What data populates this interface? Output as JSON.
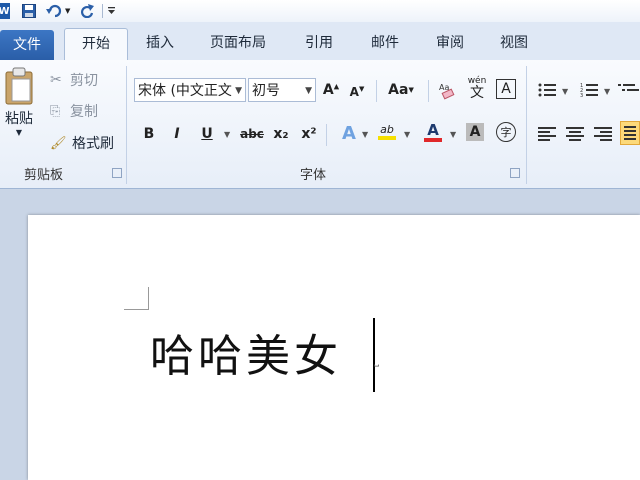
{
  "quick_access": {
    "items": [
      "word-logo",
      "save",
      "undo",
      "redo",
      "customize"
    ]
  },
  "tabs": [
    {
      "label": "文件",
      "active": false
    },
    {
      "label": "开始",
      "active": true
    },
    {
      "label": "插入",
      "active": false
    },
    {
      "label": "页面布局",
      "active": false
    },
    {
      "label": "引用",
      "active": false
    },
    {
      "label": "邮件",
      "active": false
    },
    {
      "label": "审阅",
      "active": false
    },
    {
      "label": "视图",
      "active": false
    }
  ],
  "clipboard": {
    "paste_label": "粘贴",
    "cut_label": "剪切",
    "copy_label": "复制",
    "format_painter_label": "格式刷",
    "group_label": "剪贴板"
  },
  "font": {
    "font_name": "宋体 (中文正文",
    "font_size": "初号",
    "group_label": "字体",
    "case_label": "Aa",
    "wen_label": "wén",
    "wen_char": "文",
    "char_border": "A",
    "bold": "B",
    "italic": "I",
    "underline": "U",
    "strike": "abc",
    "subscript": "x₂",
    "superscript": "x²",
    "text_effect": "A",
    "highlight": "ab",
    "font_color": "A",
    "char_shading": "A",
    "enclose_char": "字"
  },
  "colors": {
    "accent": "#2a5ea8",
    "font_color_bar": "#e0282a",
    "highlight_bar": "#f6e000"
  },
  "document": {
    "text": "哈哈美女"
  }
}
